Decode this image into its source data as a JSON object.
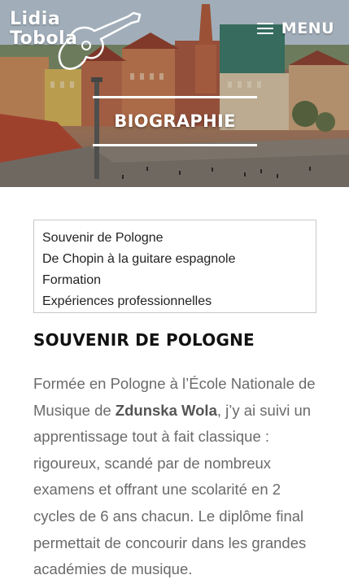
{
  "brand": {
    "name_line1": "Lidia",
    "name_line2": "Tobola"
  },
  "header": {
    "menu_label": "MENU"
  },
  "hero": {
    "title": "BIOGRAPHIE"
  },
  "toc": {
    "items": [
      {
        "label": "Souvenir de Pologne"
      },
      {
        "label": "De Chopin à la guitare espagnole"
      },
      {
        "label": "Formation"
      },
      {
        "label": "Expériences professionnelles"
      }
    ]
  },
  "section": {
    "title": "SOUVENIR DE POLOGNE",
    "paragraph_part1": "Formée en Pologne à l’École Nationale de Musique de ",
    "paragraph_bold": "Zdunska Wola",
    "paragraph_part2": ", j’y ai suivi un apprentissage tout à fait classique : rigoureux, scandé par de nombreux examens et offrant une scolarité en 2 cycles de 6 ans chacun. Le diplôme final permettait de concourir dans les grandes académies de musique."
  },
  "colors": {
    "text_dark": "#111111",
    "text_body": "#6a6a6a",
    "toc_border": "#c8c8c8",
    "hero_overlay_text": "#ffffff"
  }
}
